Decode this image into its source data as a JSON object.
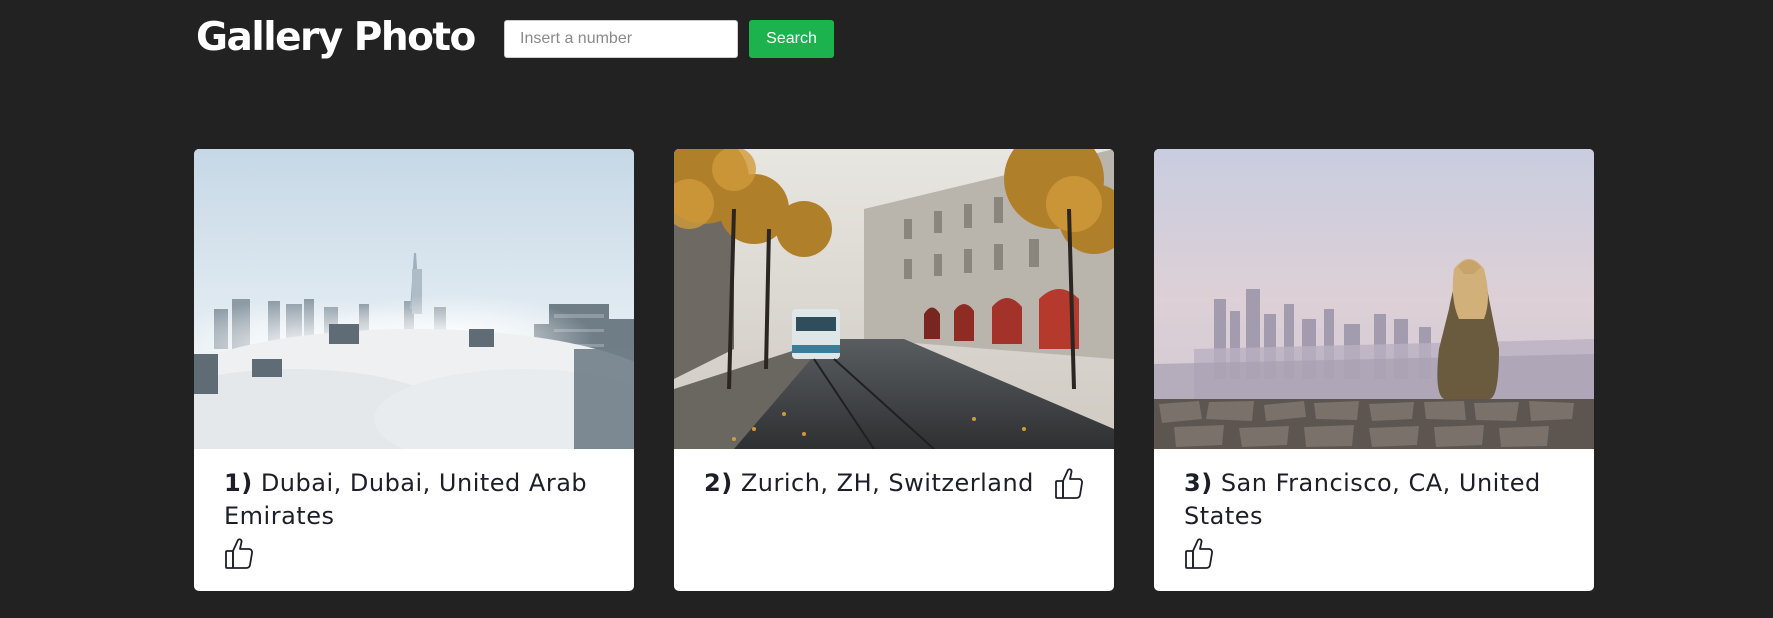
{
  "header": {
    "title": "Gallery Photo"
  },
  "search": {
    "placeholder": "Insert a number",
    "value": "",
    "button_label": "Search"
  },
  "cards": [
    {
      "number": "1)",
      "location": "Dubai, Dubai, United Arab Emirates",
      "image_alt": "City skyscrapers above clouds",
      "like_icon": "thumbs-up-icon"
    },
    {
      "number": "2)",
      "location": "Zurich, ZH, Switzerland",
      "image_alt": "Tram on autumn street",
      "like_icon": "thumbs-up-icon"
    },
    {
      "number": "3)",
      "location": "San Francisco, CA, United States",
      "image_alt": "Woman overlooking city",
      "like_icon": "thumbs-up-icon"
    }
  ],
  "colors": {
    "background": "#222222",
    "accent": "#1cb34f",
    "card": "#ffffff",
    "text": "#1e1e2a"
  }
}
